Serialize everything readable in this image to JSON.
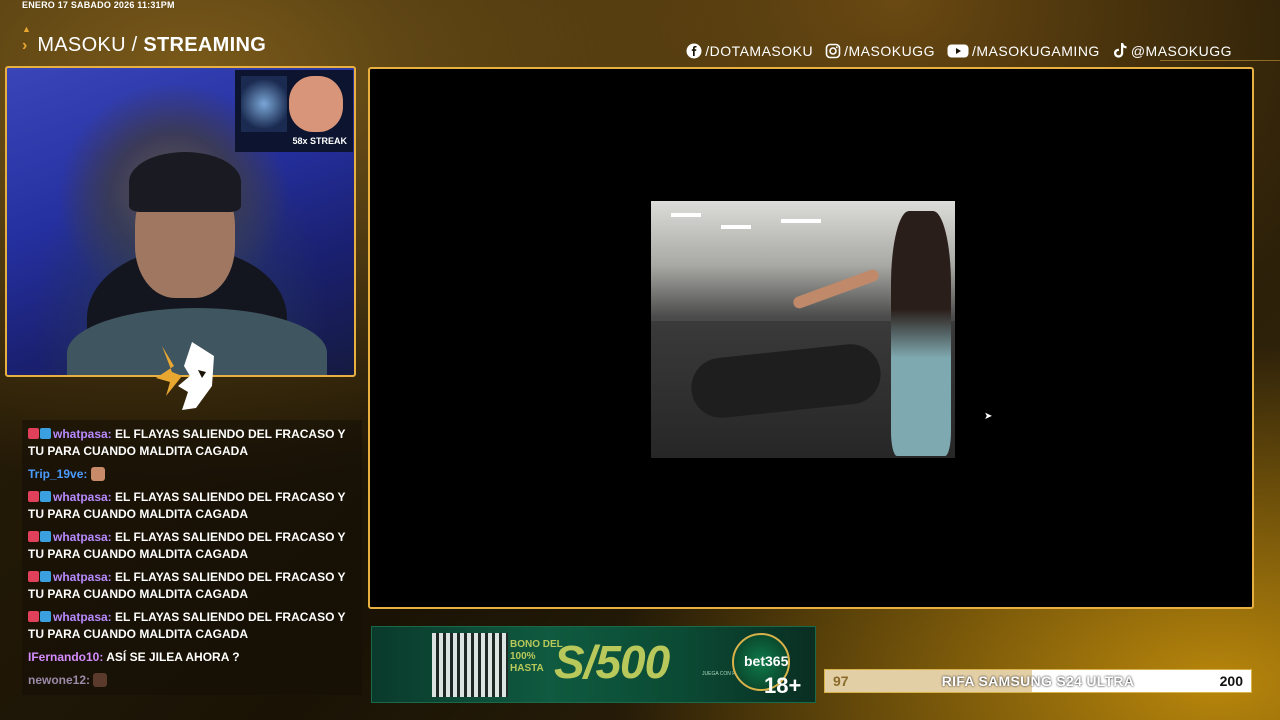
{
  "header": {
    "datetime": "ENERO 17 SABADO 2026 11:31PM",
    "brand_light": "MASOKU /",
    "brand_bold": "STREAMING"
  },
  "socials": [
    {
      "icon": "facebook-icon",
      "label": "/DOTAMASOKU"
    },
    {
      "icon": "instagram-icon",
      "label": "/MASOKUGG"
    },
    {
      "icon": "youtube-icon",
      "label": "/MASOKUGAMING"
    },
    {
      "icon": "tiktok-icon",
      "label": "@MASOKUGG"
    }
  ],
  "webcam": {
    "streak_label": "58x STREAK"
  },
  "chat": {
    "messages": [
      {
        "user": "whatpasa:",
        "text": "EL FLAYAS SALIENDO DEL FRACASO Y TU PARA CUANDO MALDITA CAGADA"
      },
      {
        "user": "Trip_19ve:",
        "text": ""
      },
      {
        "user": "whatpasa:",
        "text": "EL FLAYAS SALIENDO DEL FRACASO Y TU PARA CUANDO MALDITA CAGADA"
      },
      {
        "user": "whatpasa:",
        "text": "EL FLAYAS SALIENDO DEL FRACASO Y TU PARA CUANDO MALDITA CAGADA"
      },
      {
        "user": "whatpasa:",
        "text": "EL FLAYAS SALIENDO DEL FRACASO Y TU PARA CUANDO MALDITA CAGADA"
      },
      {
        "user": "whatpasa:",
        "text": "EL FLAYAS SALIENDO DEL FRACASO Y TU PARA CUANDO MALDITA CAGADA"
      },
      {
        "user": "IFernando10:",
        "text": "ASÍ SE JILEA AHORA ?"
      },
      {
        "user": "newone12:",
        "text": ""
      }
    ]
  },
  "ad": {
    "bono_text": "BONO DEL 100% HASTA",
    "amount": "S/500",
    "brand": "bet365",
    "age": "18+",
    "disclaimer": "JUEGA CON RESPONSABILIDAD"
  },
  "raffle": {
    "current": "97",
    "title": "RIFA SAMSUNG S24 ULTRA",
    "goal": "200",
    "progress_fraction": 0.485
  },
  "colors": {
    "accent_gold": "#e8b040",
    "chat_user_purple": "#b88aff",
    "chat_user_blue": "#4a9cff"
  }
}
